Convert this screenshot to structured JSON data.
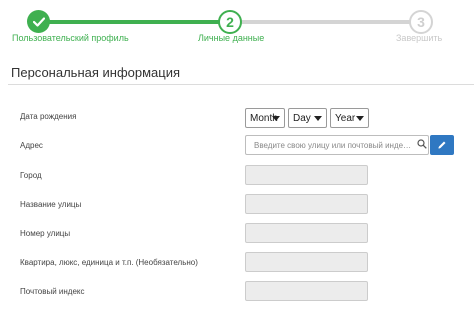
{
  "stepper": {
    "steps": [
      {
        "label": "Пользовательский профиль",
        "state": "complete"
      },
      {
        "number": "2",
        "label": "Личные данные",
        "state": "active"
      },
      {
        "number": "3",
        "label": "Завершить",
        "state": "pending"
      }
    ],
    "colors": {
      "complete": "#3fb050",
      "pending": "#d4d4d4",
      "edit_button": "#2f78c2"
    }
  },
  "section": {
    "title": "Персональная информация"
  },
  "form": {
    "birth_date": {
      "label": "Дата рождения",
      "month": "Month",
      "day": "Day",
      "year": "Year"
    },
    "address": {
      "label": "Адрес",
      "placeholder": "Введите свою улицу или почтовый индекс..."
    },
    "city": {
      "label": "Город",
      "value": ""
    },
    "street_name": {
      "label": "Название улицы",
      "value": ""
    },
    "street_number": {
      "label": "Номер улицы",
      "value": ""
    },
    "apartment": {
      "label": "Квартира, люкс, единица и т.п. (Необязательно)",
      "value": ""
    },
    "postal_code": {
      "label": "Почтовый индекс",
      "value": ""
    }
  }
}
